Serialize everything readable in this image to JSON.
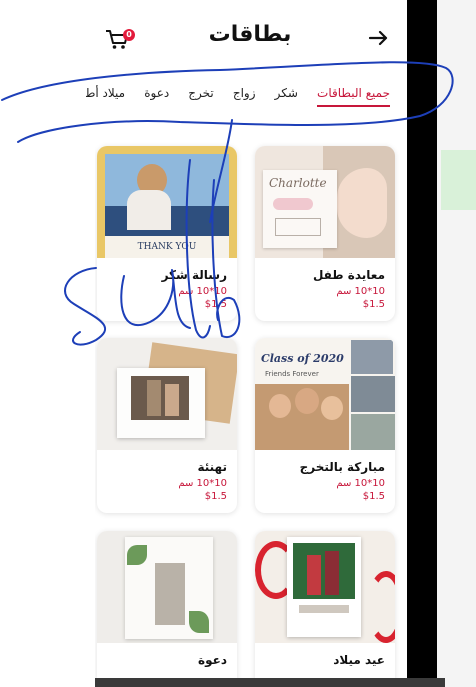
{
  "header": {
    "title": "بطاقات",
    "cart_count": "0"
  },
  "tabs": [
    {
      "label": "جميع البطاقات",
      "active": true
    },
    {
      "label": "شكر",
      "active": false
    },
    {
      "label": "زواج",
      "active": false
    },
    {
      "label": "تخرج",
      "active": false
    },
    {
      "label": "دعوة",
      "active": false
    },
    {
      "label": "ميلاد أطف",
      "active": false
    }
  ],
  "cards": [
    {
      "name": "معايدة طفل",
      "size": "10*10 سم",
      "price": "$1.5",
      "image_text": "Charlotte"
    },
    {
      "name": "رسالة شكر",
      "size": "10*10 سم",
      "price": "$1.5",
      "image_text": "THANK YOU"
    },
    {
      "name": "مباركة بالتخرج",
      "size": "10*10 سم",
      "price": "$1.5",
      "image_text": "Class of 2020",
      "image_subtext": "Friends Forever"
    },
    {
      "name": "تهنئة",
      "size": "10*10 سم",
      "price": "$1.5"
    },
    {
      "name": "عيد ميلاد",
      "size": "",
      "price": ""
    },
    {
      "name": "دعوة",
      "size": "",
      "price": ""
    }
  ],
  "colors": {
    "accent": "#c7163a",
    "badge": "#e31b3c",
    "scribble": "#1d3fb8"
  }
}
